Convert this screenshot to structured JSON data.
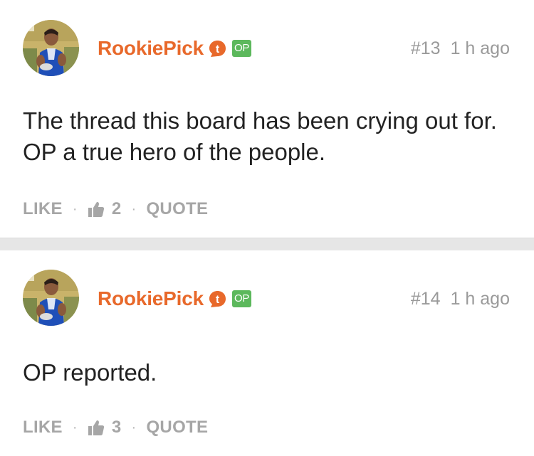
{
  "colors": {
    "username": "#e8692b",
    "op_badge": "#5cb85c",
    "t_badge": "#e8692b",
    "meta_text": "#9a9a9a",
    "action_text": "#a6a6a6",
    "separator": "#e6e6e6"
  },
  "posts": [
    {
      "username": "RookiePick",
      "badge_icon": "t-badge-icon",
      "badge_text": "t",
      "op_badge": "OP",
      "number": "#13",
      "time": "1 h ago",
      "body": "The thread this board has been crying out for. OP a true hero of the people.",
      "actions": {
        "like": "LIKE",
        "like_count": "2",
        "quote": "QUOTE"
      }
    },
    {
      "username": "RookiePick",
      "badge_icon": "t-badge-icon",
      "badge_text": "t",
      "op_badge": "OP",
      "number": "#14",
      "time": "1 h ago",
      "body": "OP reported.",
      "actions": {
        "like": "LIKE",
        "like_count": "3",
        "quote": "QUOTE"
      }
    }
  ]
}
